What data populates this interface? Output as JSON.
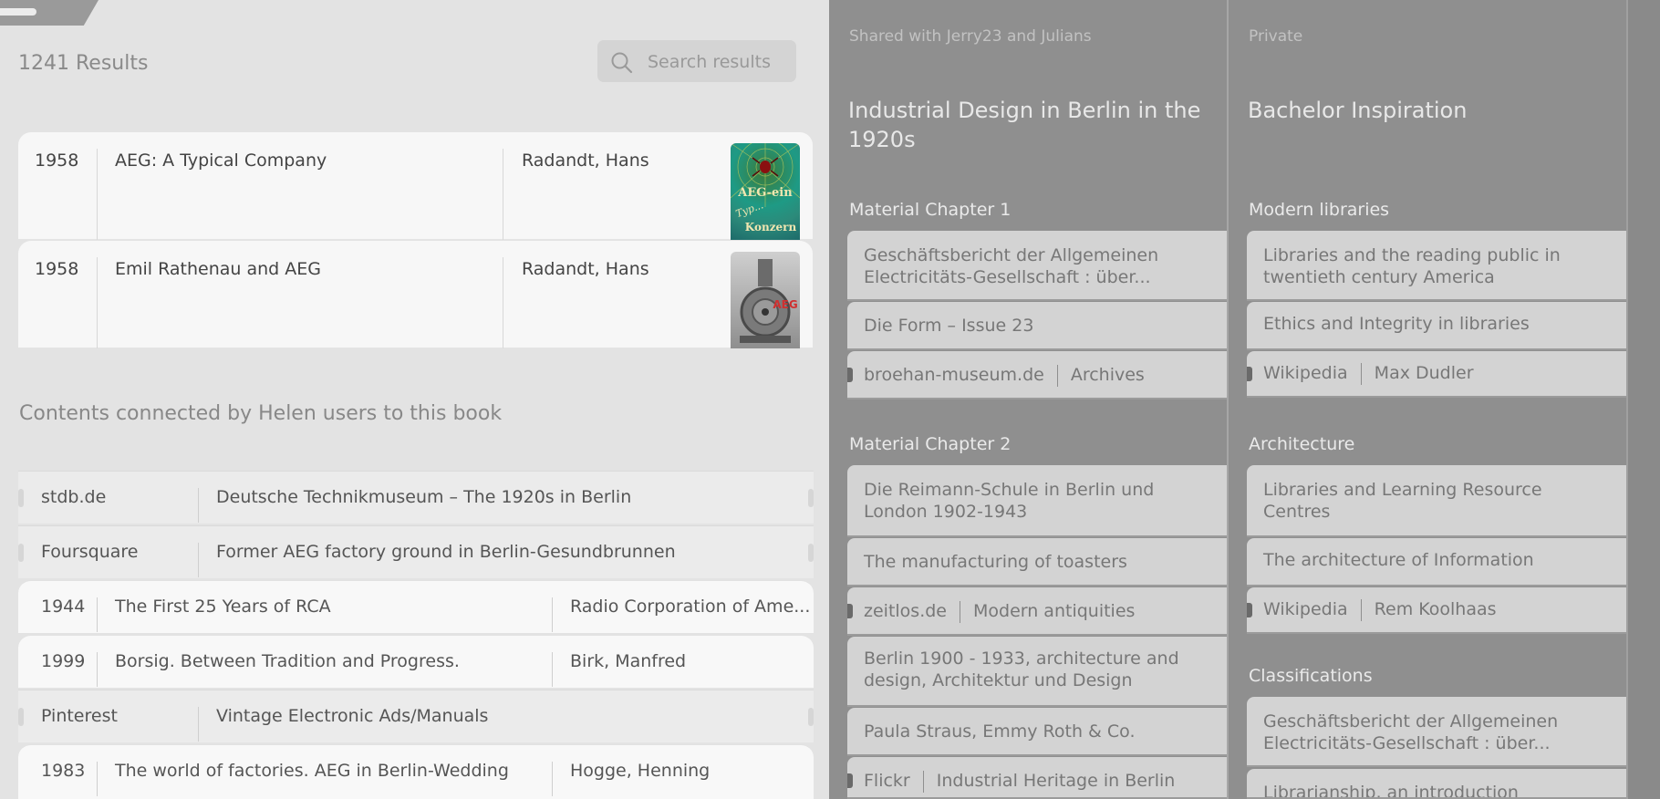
{
  "results": {
    "count_label": "1241 Results",
    "search_placeholder": "Search results"
  },
  "books": [
    {
      "year": "1958",
      "title": "AEG: A Typical Company",
      "author": "Radandt, Hans",
      "cover_text": "AEG-ein Typischer Konzern"
    },
    {
      "year": "1958",
      "title": "Emil Rathenau and AEG",
      "author": "Radandt, Hans",
      "cover_text": "AEG"
    }
  ],
  "connected": {
    "heading": "Contents connected by Helen users to this book",
    "items": [
      {
        "kind": "web",
        "source": "stdb.de",
        "name": "Deutsche Technikmuseum – The 1920s in Berlin"
      },
      {
        "kind": "web",
        "source": "Foursquare",
        "name": "Former AEG factory ground in Berlin-Gesundbrunnen"
      },
      {
        "kind": "book",
        "year": "1944",
        "name": "The First 25 Years of RCA",
        "author": "Radio Corporation of Ame..."
      },
      {
        "kind": "book",
        "year": "1999",
        "name": "Borsig. Between Tradition and Progress.",
        "author": "Birk, Manfred"
      },
      {
        "kind": "web",
        "source": "Pinterest",
        "name": "Vintage Electronic Ads/Manuals"
      },
      {
        "kind": "book",
        "year": "1983",
        "name": "The world of factories. AEG in Berlin-Wedding",
        "author": "Hogge, Henning"
      }
    ]
  },
  "collection1": {
    "label": "Shared with Jerry23 and Julians",
    "title": "Industrial Design in Berlin in the 1920s",
    "sections": [
      {
        "title": "Material Chapter 1",
        "cards": [
          {
            "text": "Geschäftsbericht der Allgemeinen Electricitäts-Gesellschaft : über..."
          },
          {
            "text": "Die Form – Issue 23"
          },
          {
            "source": "broehan-museum.de",
            "link": "Archives"
          }
        ]
      },
      {
        "title": "Material Chapter 2",
        "cards": [
          {
            "text": "Die Reimann-Schule in Berlin und London 1902-1943"
          },
          {
            "text": "The manufacturing of toasters"
          },
          {
            "source": "zeitlos.de",
            "link": "Modern antiquities"
          },
          {
            "text": "Berlin 1900 - 1933, architecture and design, Architektur und Design"
          },
          {
            "text": "Paula Straus, Emmy Roth & Co."
          },
          {
            "source": "Flickr",
            "link": "Industrial Heritage in Berlin"
          }
        ]
      }
    ]
  },
  "collection2": {
    "label": "Private",
    "title": "Bachelor Inspiration",
    "sections": [
      {
        "title": "Modern libraries",
        "cards": [
          {
            "text": "Libraries and  the reading public in twentieth century America"
          },
          {
            "text": "Ethics and Integrity in libraries"
          },
          {
            "source": "Wikipedia",
            "link": "Max Dudler"
          }
        ]
      },
      {
        "title": "Architecture",
        "cards": [
          {
            "text": "Libraries and Learning Resource Centres"
          },
          {
            "text": "The architecture of Information"
          },
          {
            "source": "Wikipedia",
            "link": "Rem Koolhaas"
          }
        ]
      },
      {
        "title": "Classifications",
        "cards": [
          {
            "text": "Geschäftsbericht der Allgemeinen Electricitäts-Gesellschaft : über..."
          },
          {
            "text": "Librarianship, an introduction"
          }
        ]
      }
    ]
  },
  "colors": {
    "panel_bg": "#8f8f8f",
    "card_bg": "#d3d3d3",
    "list_bg": "#e3e3e3"
  }
}
